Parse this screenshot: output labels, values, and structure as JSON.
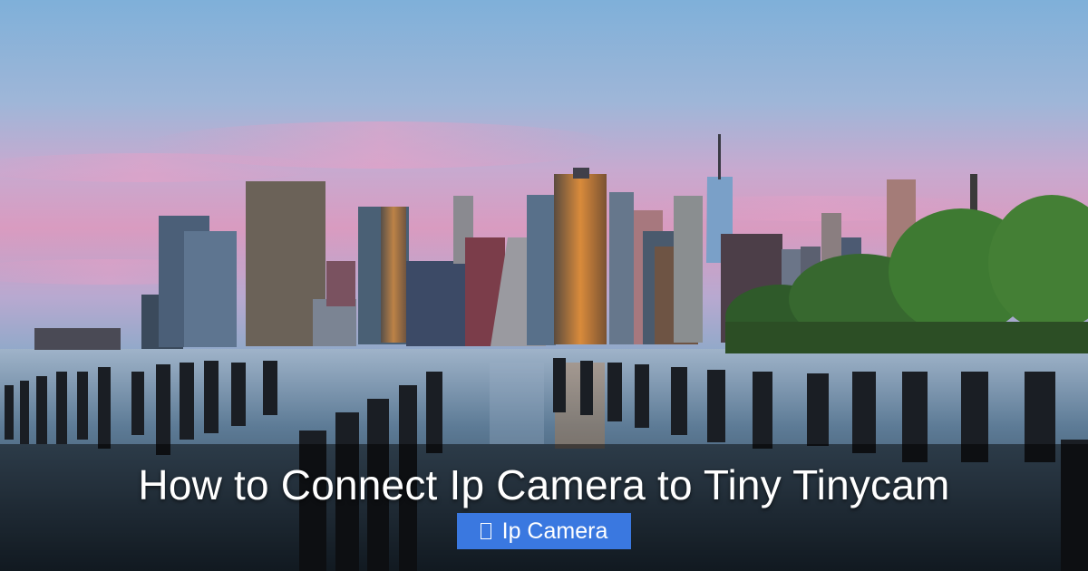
{
  "article": {
    "title": "How to Connect Ip Camera to Tiny Tinycam",
    "category": {
      "label": "Ip Camera",
      "icon": "tag-icon"
    }
  },
  "colors": {
    "badge_background": "#3a78e0",
    "title_text": "#ffffff",
    "caption_overlay": "rgba(0,0,0,0.48)"
  }
}
